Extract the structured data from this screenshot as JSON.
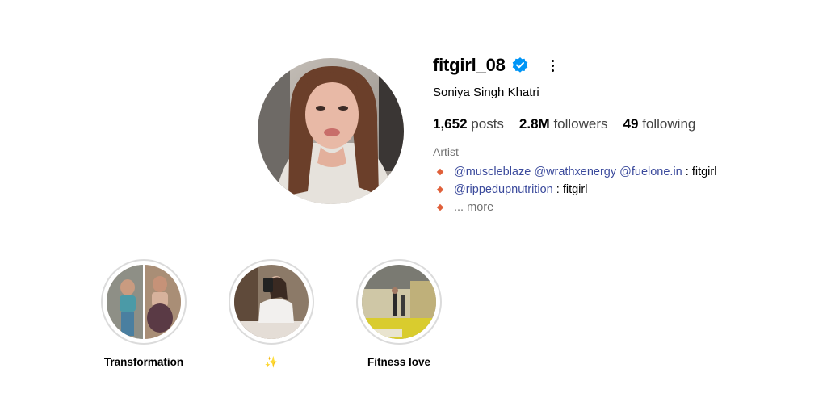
{
  "profile": {
    "username": "fitgirl_08",
    "full_name": "Soniya Singh Khatri",
    "category": "Artist",
    "verified_icon": "verified-badge-icon",
    "more_icon": "more-options-icon",
    "stats": {
      "posts_count": "1,652",
      "posts_label": "posts",
      "followers_count": "2.8M",
      "followers_label": "followers",
      "following_count": "49",
      "following_label": "following"
    },
    "bio": {
      "line1_mentions": [
        "@muscleblaze",
        "@wrathxenergy",
        "@fuelone.in"
      ],
      "line1_suffix": ": fitgirl",
      "line2_mention": "@rippedupnutrition",
      "line2_suffix": ": fitgirl",
      "more": "... more",
      "bullet_color": "#e0603a"
    }
  },
  "highlights": [
    {
      "label": "Transformation"
    },
    {
      "label": "✨"
    },
    {
      "label": "Fitness love"
    }
  ],
  "colors": {
    "verified": "#0095f6",
    "mention": "#3b4a9c",
    "muted": "#737373"
  }
}
